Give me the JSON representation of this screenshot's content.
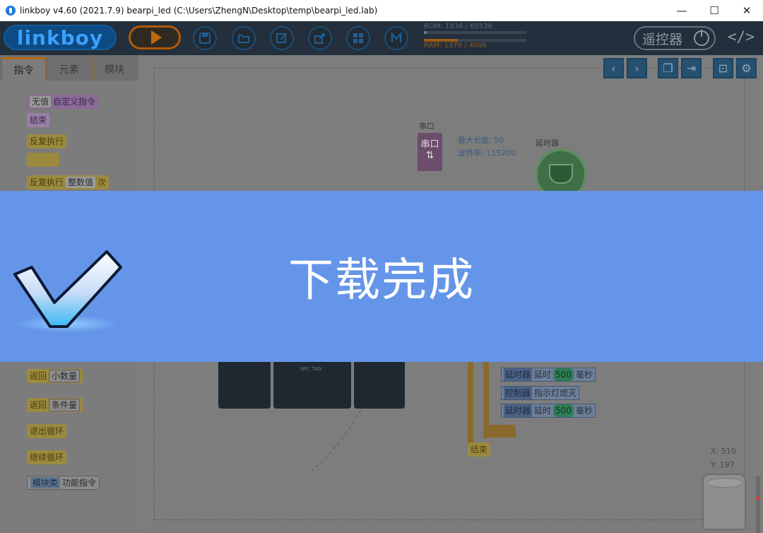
{
  "window": {
    "title": "linkboy v4.60 (2021.7.9) bearpi_led (C:\\Users\\ZhengN\\Desktop\\temp\\bearpi_led.lab)",
    "minimize": "—",
    "maximize": "☐",
    "close": "✕"
  },
  "toolbar": {
    "logo": "linkboy",
    "rom_label": "ROM: 1836 / 65536",
    "ram_label": "RAM: 1370 / 4096",
    "rom_fraction": 0.028,
    "ram_fraction": 0.33,
    "remote_label": "遥控器",
    "code_label": "</>",
    "accent": "#0e5da3",
    "run_color": "#c06a0b"
  },
  "left_panel": {
    "tabs": [
      "指令",
      "元素",
      "模块"
    ],
    "blocks": {
      "none_val": "无值",
      "custom_cmd": "自定义指令",
      "end": "结束",
      "repeat": "反复执行",
      "repeat_n_prefix": "反复执行",
      "repeat_n_slot": "整数值",
      "repeat_n_suffix": "次",
      "return_1": "返回",
      "return_1_slot": "小数量",
      "return_2": "返回",
      "return_2_slot": "条件量",
      "exit_loop": "退出循环",
      "continue_loop": "继续循环",
      "module_class": "模块类",
      "func_cmd": "功能指令"
    }
  },
  "canvas": {
    "uart_label": "串口",
    "uart_title": "串口",
    "uart_max_len": "最大长度: 50",
    "uart_baud": "波特率: 115200",
    "timer_label": "延时器",
    "nfc_label": "NFC TAG",
    "blocks": {
      "r1_tag": "延时器",
      "r1_text": "延时",
      "r1_num": "500",
      "r1_unit": "毫秒",
      "r2_tag": "控制器",
      "r2_text": "指示灯熄灭",
      "r3_tag": "延时器",
      "r3_text": "延时",
      "r3_num": "500",
      "r3_unit": "毫秒",
      "end": "结束"
    },
    "coord_x": "X: 510",
    "coord_y": "Y: 197"
  },
  "banner": {
    "message": "下载完成",
    "background": "#6495e9"
  }
}
